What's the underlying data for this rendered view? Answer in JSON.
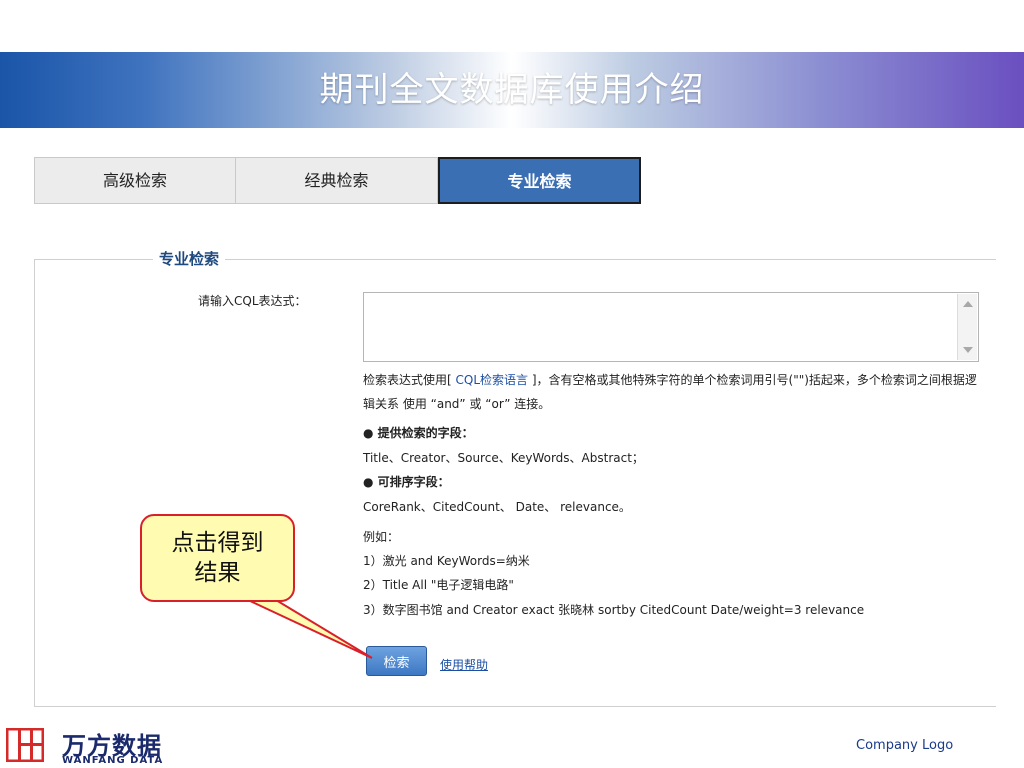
{
  "slide": {
    "title": "期刊全文数据库使用介绍"
  },
  "tabs": [
    {
      "label": "高级检索",
      "active": false
    },
    {
      "label": "经典检索",
      "active": false
    },
    {
      "label": "专业检索",
      "active": true
    }
  ],
  "panel": {
    "legend": "专业检索",
    "cql_label": "请输入CQL表达式：",
    "cql_value": "",
    "help_prefix": "检索表达式使用[ ",
    "help_link": "CQL检索语言",
    "help_suffix": " ]，含有空格或其他特殊字符的单个检索词用引号(\"\")括起来，多个检索词之间根据逻辑关系 使用 “and” 或 “or” 连接。",
    "fields_title": "● 提供检索的字段：",
    "fields": "Title、Creator、Source、KeyWords、Abstract；",
    "sort_title": "● 可排序字段：",
    "sort_fields": "CoreRank、CitedCount、 Date、 relevance。",
    "example_title": "例如：",
    "examples": [
      "1）激光 and KeyWords=纳米",
      "2）Title All \"电子逻辑电路\"",
      "3）数字图书馆 and Creator exact 张晓林 sortby CitedCount Date/weight=3 relevance"
    ],
    "search_button": "检索",
    "help_link_text": "使用帮助"
  },
  "callout": {
    "line1": "点击得到",
    "line2": "结果"
  },
  "footer": {
    "logo_cn": "万方数据",
    "logo_en": "WANFANG DATA",
    "company_logo": "Company Logo"
  },
  "colors": {
    "tab_active": "#3a6fb3",
    "callout_fill": "#fffbb0",
    "callout_border": "#d9202a",
    "link": "#1c4fa3"
  }
}
